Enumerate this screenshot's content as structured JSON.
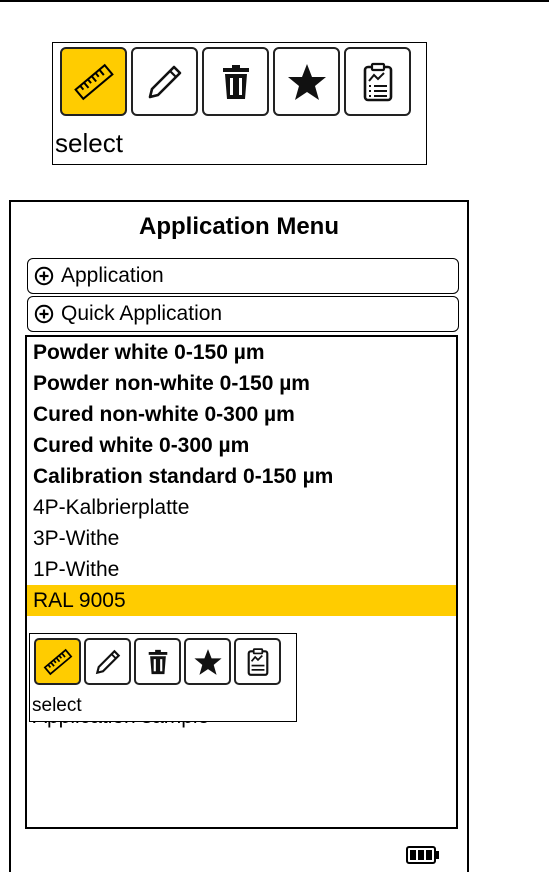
{
  "toolbar_top": {
    "icons": [
      "ruler-icon",
      "pencil-icon",
      "trash-icon",
      "star-icon",
      "clipboard-icon"
    ],
    "active_index": 0,
    "label": "select"
  },
  "device": {
    "title": "Application Menu",
    "expanders": [
      {
        "label": "Application",
        "icon": "plus-circle-icon"
      },
      {
        "label": "Quick Application",
        "icon": "plus-circle-icon"
      }
    ],
    "applications": [
      {
        "label": "Powder white 0-150 µm",
        "bold": true
      },
      {
        "label": "Powder non-white 0-150 µm",
        "bold": true
      },
      {
        "label": "Cured non-white 0-300 µm",
        "bold": true
      },
      {
        "label": "Cured white 0-300 µm",
        "bold": true
      },
      {
        "label": "Calibration standard 0-150 µm",
        "bold": true
      },
      {
        "label": "4P-Kalbrierplatte",
        "bold": false
      },
      {
        "label": "3P-Withe",
        "bold": false
      },
      {
        "label": "1P-Withe",
        "bold": false
      },
      {
        "label": "RAL 9005",
        "bold": false,
        "selected": true
      }
    ],
    "partially_hidden_item": "Application sample",
    "popup_toolbar": {
      "icons": [
        "ruler-icon",
        "pencil-icon",
        "trash-icon",
        "star-icon",
        "clipboard-icon"
      ],
      "active_index": 0,
      "label": "select"
    },
    "battery_icon": "battery-full-icon"
  },
  "colors": {
    "accent": "#ffcc00",
    "border": "#000000",
    "background": "#ffffff"
  }
}
